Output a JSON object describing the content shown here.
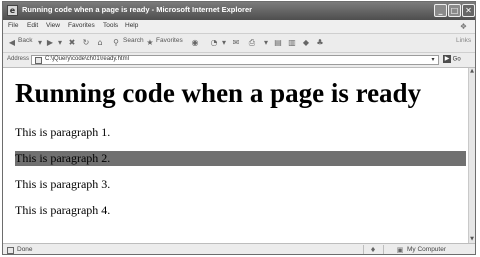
{
  "window": {
    "title": "Running code when a page is ready - Microsoft Internet Explorer",
    "controls": {
      "minimize": "_",
      "maximize": "□",
      "close": "✕"
    }
  },
  "menu": [
    "File",
    "Edit",
    "View",
    "Favorites",
    "Tools",
    "Help"
  ],
  "toolbar": {
    "back_label": "Back",
    "search_label": "Search",
    "favorites_label": "Favorites",
    "links_label": "Links"
  },
  "address": {
    "label": "Address",
    "value": "C:\\jQuery\\code\\ch01\\ready.html",
    "go_label": "Go"
  },
  "page": {
    "heading": "Running code when a page is ready",
    "paragraphs": [
      {
        "text": "This is paragraph 1."
      },
      {
        "text": "This is paragraph 2.",
        "highlighted": true
      },
      {
        "text": "This is paragraph 3."
      },
      {
        "text": "This is paragraph 4."
      }
    ],
    "highlight_color": "#707070"
  },
  "status": {
    "text": "Done",
    "zone": "My Computer"
  }
}
